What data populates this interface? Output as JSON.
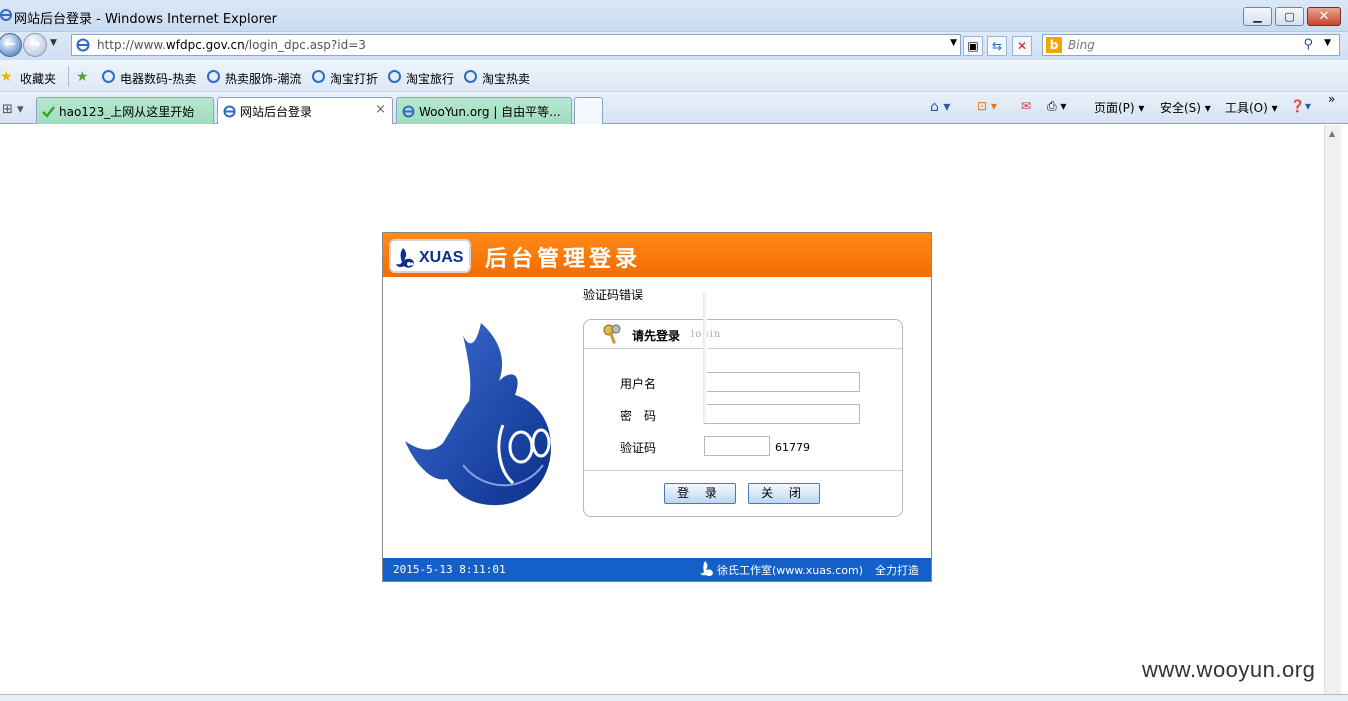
{
  "window": {
    "title": "网站后台登录 - Windows Internet Explorer"
  },
  "address_bar": {
    "url_prefix": "http://www.",
    "url_domain": "wfdpc.gov.cn",
    "url_path": "/login_dpc.asp?id=3"
  },
  "search": {
    "placeholder": "Bing",
    "logo": "b"
  },
  "favorites": {
    "label": "收藏夹",
    "items": [
      {
        "label": "电器数码-热卖"
      },
      {
        "label": "热卖服饰-潮流"
      },
      {
        "label": "淘宝打折"
      },
      {
        "label": "淘宝旅行"
      },
      {
        "label": "淘宝热卖"
      }
    ]
  },
  "tabs": [
    {
      "label": "hao123_上网从这里开始",
      "icon": "hao123-icon"
    },
    {
      "label": "网站后台登录",
      "icon": "ie-icon",
      "active": true
    },
    {
      "label": "WooYun.org | 自由平等...",
      "icon": "ie-icon"
    }
  ],
  "command_bar": {
    "page": "页面(P)",
    "safety": "安全(S)",
    "tools": "工具(O)"
  },
  "login": {
    "logo_text": "XUAS",
    "title": "后台管理登录",
    "error": "验证码错误",
    "panel_title": "请先登录",
    "panel_sub": "login",
    "username_label": "用户名",
    "password_label": "密　码",
    "captcha_label": "验证码",
    "captcha_code": "61779",
    "submit_label": "登 录",
    "close_label": "关 闭",
    "footer_date": "2015-5-13 8:11:01",
    "footer_credit": "徐氏工作室(www.xuas.com)",
    "footer_made": "全力打造"
  },
  "watermark": "www.wooyun.org",
  "colors": {
    "header_orange": "#f36c00",
    "footer_blue": "#1560c8",
    "logo_blue": "#0c2f8a"
  }
}
